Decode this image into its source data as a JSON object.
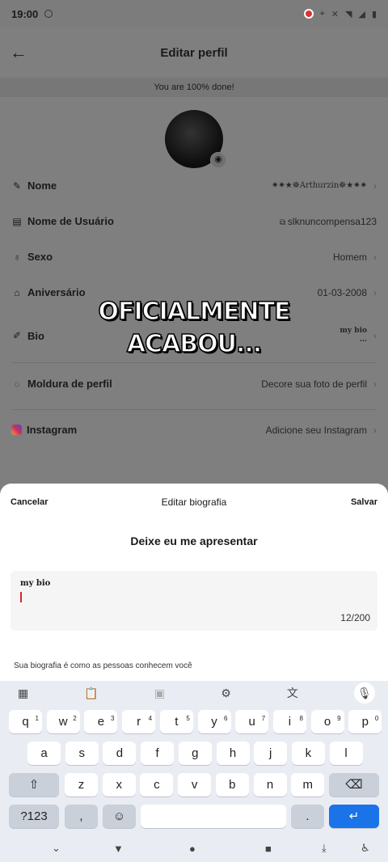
{
  "status": {
    "time": "19:00"
  },
  "profile": {
    "title": "Editar perfil",
    "banner": "You are 100% done!",
    "rows": [
      {
        "label": "Nome",
        "value": "✷✷★☸Arthurzin☸★✷✷"
      },
      {
        "label": "Nome de Usuário",
        "value": "slknuncompensa123"
      },
      {
        "label": "Sexo",
        "value": "Homem"
      },
      {
        "label": "Aniversário",
        "value": "01-03-2008"
      },
      {
        "label": "Bio",
        "value": "my bio"
      },
      {
        "label": "Moldura de perfil",
        "value": "Decore sua foto de perfil"
      },
      {
        "label": "Instagram",
        "value": "Adicione seu Instagram"
      }
    ]
  },
  "overlay": {
    "line1": "OFICIALMENTE",
    "line2": "ACABOU..."
  },
  "sheet": {
    "cancel": "Cancelar",
    "title": "Editar biografia",
    "save": "Salvar",
    "heading": "Deixe eu me apresentar",
    "bio_value": "my bio",
    "counter": "12/200",
    "hint": "Sua biografia é como as pessoas conhecem você"
  },
  "keyboard": {
    "row1": [
      "q",
      "w",
      "e",
      "r",
      "t",
      "y",
      "u",
      "i",
      "o",
      "p"
    ],
    "row1_nums": [
      "1",
      "2",
      "3",
      "4",
      "5",
      "6",
      "7",
      "8",
      "9",
      "0"
    ],
    "row2": [
      "a",
      "s",
      "d",
      "f",
      "g",
      "h",
      "j",
      "k",
      "l"
    ],
    "row3": [
      "z",
      "x",
      "c",
      "v",
      "b",
      "n",
      "m"
    ],
    "sym": "?123",
    "comma": ",",
    "period": "."
  }
}
